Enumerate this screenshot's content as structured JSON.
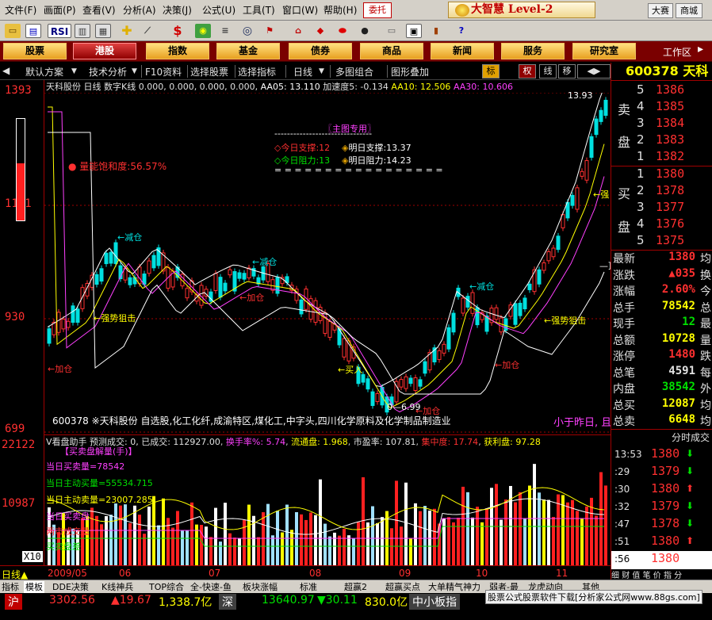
{
  "menubar": {
    "items": [
      "文件(F)",
      "画面(P)",
      "查看(V)",
      "分析(A)",
      "决策(J)",
      "公式(U)",
      "工具(T)",
      "窗口(W)",
      "帮助(H)"
    ],
    "entrust": "委托",
    "brand": "大智慧 Level-2",
    "right_buttons": [
      "大赛",
      "商城"
    ]
  },
  "toolbar": {
    "icons": [
      "open-folder-icon",
      "chart-icon",
      "rsi-icon",
      "grid-icon",
      "crosshair-icon",
      "ruler-icon",
      "dollar-icon",
      "indicator-icon",
      "binoculars-icon",
      "flag-icon",
      "house-icon",
      "diamond-icon",
      "pill-icon",
      "book-icon",
      "calculator-icon",
      "notebook-icon",
      "window-icon",
      "bookshelf-icon",
      "help-icon"
    ],
    "rsi_label": "RSI",
    "dollar_label": "$"
  },
  "navbar": {
    "buttons": [
      "股票",
      "港股",
      "指数",
      "基金",
      "债券",
      "商品",
      "新闻",
      "服务",
      "研究室"
    ],
    "active": "港股",
    "workspace": "工作区"
  },
  "subbar": {
    "items": [
      "默认方案",
      "技术分析",
      "F10资料",
      "选择股票",
      "选择指标",
      "日线",
      "多图组合",
      "图形叠加"
    ],
    "toggles": [
      "标",
      "权",
      "线",
      "移"
    ]
  },
  "chart_info": {
    "name": "天科股份",
    "period": "日线",
    "indicator": "数字K线",
    "values": "0.000, 0.000, 0.000, 0.000,",
    "aa05": "AA05: 13.110",
    "speed": "加速度5: -0.134",
    "aa10": "AA10: 12.506",
    "aa30": "AA30: 10.606"
  },
  "y_axis": {
    "main": [
      "1393",
      "1161",
      "930",
      "699"
    ],
    "sub": [
      "22122",
      "10987",
      "X10"
    ]
  },
  "x_axis": {
    "labels": [
      "2009/05",
      "06",
      "07",
      "08",
      "09",
      "10",
      "11"
    ],
    "period_label": "日线"
  },
  "annotations": {
    "saturation": "量能饱和度:56.57%",
    "main_title": "〖主图专用〗",
    "dashes_top": "-------------------------------",
    "support_today": "今日支撑:12",
    "support_tomorrow": "明日支撑:13.37",
    "resist_today": "今日阻力:13",
    "resist_tomorrow": "明日阻力:14.23",
    "dashes_bottom": "= = = = = = = = = = = = = = = = =",
    "stock_desc": "600378  ※天科股份  自选股,化工化纤,成渝特区,煤化工,中字头,四川化学原料及化学制品制造业",
    "desc_tail": "小于昨日, 且",
    "jiancang": "减仓",
    "jiacang": "加仓",
    "qiangshi": "强势狙击",
    "mairu": "买入",
    "qiang": "强",
    "low_price": "6.99",
    "high_price": "13.93",
    "ding": "顶"
  },
  "sub_chart": {
    "title": "V看盘助手",
    "predicted": "预测成交: 0, 已成交: 112927.00",
    "turnover": "换手率%: 5.74",
    "float": "流通盘: 1.968",
    "pe": "市盈率: 107.81",
    "concentration": "集中度: 17.74",
    "profit": "获利盘: 97.28",
    "section": "【买卖盘解量(手)】",
    "buy_vol": "当日买卖量=78542",
    "active_buy": "当日主动买量=55534.715",
    "active_sell": "当日主动卖量=23007.285",
    "buy_pct": "当日买卖盘",
    "market_vol": "两市成交量",
    "current": "买卖盘差",
    "x10": "X10"
  },
  "right_panel": {
    "code": "600378",
    "name": "天科",
    "sell": {
      "label_top": "卖",
      "label_bottom": "盘",
      "levels": [
        "5",
        "4",
        "3",
        "2",
        "1"
      ],
      "prices": [
        "1386",
        "1385",
        "1384",
        "1383",
        "1382"
      ]
    },
    "buy": {
      "label_top": "买",
      "label_bottom": "盘",
      "levels": [
        "1",
        "2",
        "3",
        "4",
        "5"
      ],
      "prices": [
        "1380",
        "1378",
        "1377",
        "1376",
        "1375"
      ]
    },
    "quotes": [
      {
        "label": "最新",
        "value": "1380",
        "color": "red",
        "right": "均"
      },
      {
        "label": "涨跌",
        "value": "▲035",
        "color": "red",
        "right": "换"
      },
      {
        "label": "涨幅",
        "value": "2.60%",
        "color": "red",
        "right": "今"
      },
      {
        "label": "总手",
        "value": "78542",
        "color": "yellow",
        "right": "总"
      },
      {
        "label": "现手",
        "value": "12",
        "color": "green",
        "right": "最"
      },
      {
        "label": "总额",
        "value": "10728",
        "color": "yellow",
        "right": "量"
      },
      {
        "label": "涨停",
        "value": "1480",
        "color": "red",
        "right": "跌"
      },
      {
        "label": "总笔",
        "value": "4591",
        "color": "white",
        "right": "每"
      },
      {
        "label": "内盘",
        "value": "38542",
        "color": "green",
        "right": "外"
      },
      {
        "label": "总买",
        "value": "12087",
        "color": "yellow",
        "right": "均"
      },
      {
        "label": "总卖",
        "value": "6648",
        "color": "yellow",
        "right": "均"
      }
    ],
    "tick_header": "分时成交",
    "ticks": [
      {
        "time": "13:53",
        "price": "1380",
        "dir": "down"
      },
      {
        "time": ":29",
        "price": "1379",
        "dir": "down"
      },
      {
        "time": ":30",
        "price": "1380",
        "dir": "up"
      },
      {
        "time": ":32",
        "price": "1379",
        "dir": "down"
      },
      {
        "time": ":47",
        "price": "1378",
        "dir": "down"
      },
      {
        "time": ":51",
        "price": "1380",
        "dir": "up"
      },
      {
        "time": ":56",
        "price": "1380",
        "dir": ""
      }
    ],
    "tick_tabs": [
      "细",
      "财",
      "值",
      "笔",
      "价",
      "指",
      "分"
    ]
  },
  "tabs": [
    "指标",
    "模板",
    "DDE决策",
    "K线神兵",
    "TOP综合",
    "全-快速-鱼",
    "板块涨幅",
    "标准",
    "超赢2",
    "超赢买点",
    "大单精气神力",
    "弱者-最",
    "龙虎动向",
    "其他"
  ],
  "ticker": {
    "sh_label": "沪",
    "sh_index": "3302.56",
    "sh_change": "▲19.67",
    "sh_amount": "1,338.7亿",
    "sz_label": "深",
    "sz_index": "13640.97",
    "sz_change": "▼30.11",
    "sz_amount": "830.0亿",
    "board": "中小板指",
    "ad": "股票公式股票软件下载[分析家公式网www.88gs.com]"
  },
  "colors": {
    "up": "#ff3030",
    "down": "#00e0e0",
    "ma1": "#ffffff",
    "ma2": "#ffff00",
    "ma3": "#ff40ff"
  }
}
